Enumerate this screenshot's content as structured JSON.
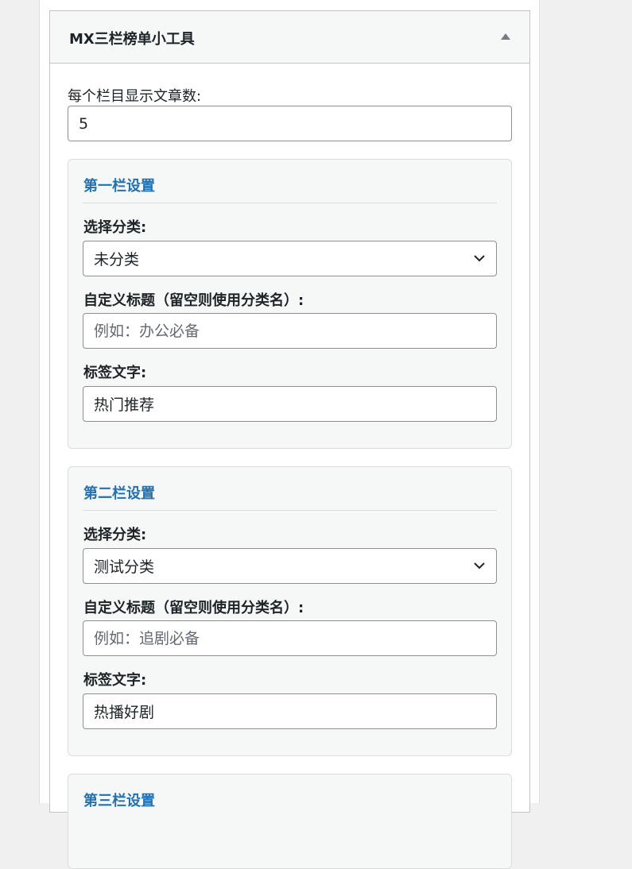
{
  "widget": {
    "title": "MX三栏榜单小工具",
    "posts_per_column_label": "每个栏目显示文章数:",
    "posts_per_column_value": "5"
  },
  "sections": [
    {
      "title": "第一栏设置",
      "category_label": "选择分类:",
      "category_selected": "未分类",
      "custom_title_label": "自定义标题（留空则使用分类名）:",
      "custom_title_placeholder": "例如：办公必备",
      "custom_title_value": "",
      "tag_label": "标签文字:",
      "tag_value": "热门推荐"
    },
    {
      "title": "第二栏设置",
      "category_label": "选择分类:",
      "category_selected": "测试分类",
      "custom_title_label": "自定义标题（留空则使用分类名）:",
      "custom_title_placeholder": "例如：追剧必备",
      "custom_title_value": "",
      "tag_label": "标签文字:",
      "tag_value": "热播好剧"
    },
    {
      "title": "第三栏设置"
    }
  ],
  "colors": {
    "accent": "#2271b1",
    "border": "#8c8f94",
    "section_bg": "#f6f7f7"
  },
  "icons": {
    "toggle": "triangle-up-icon",
    "dropdown": "chevron-down-icon"
  }
}
